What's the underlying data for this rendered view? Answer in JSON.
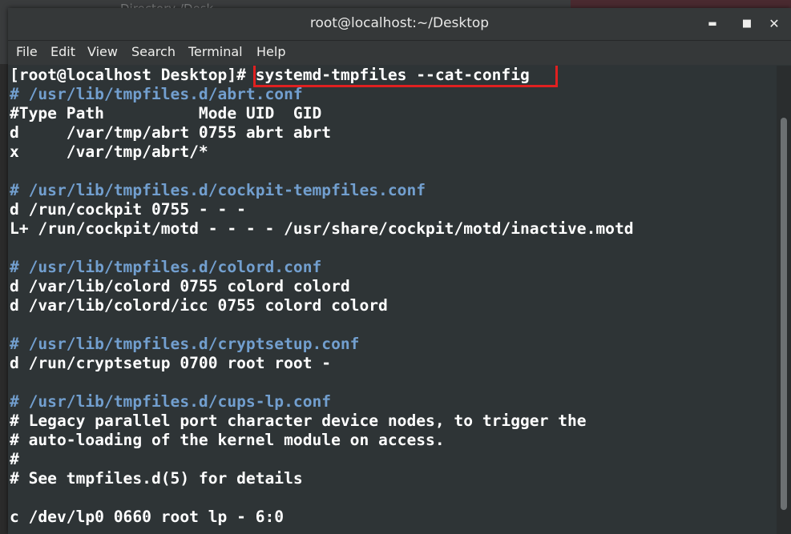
{
  "window": {
    "title": "root@localhost:~/Desktop",
    "bg_title": "Directory /Desk"
  },
  "controls": {
    "minimize": "▬",
    "maximize": "■",
    "close": "✕"
  },
  "menu": {
    "items": [
      "File",
      "Edit",
      "View",
      "Search",
      "Terminal",
      "Help"
    ]
  },
  "terminal": {
    "prompt": "[root@localhost Desktop]# ",
    "command": "systemd-tmpfiles --cat-config",
    "lines": [
      {
        "text": "# /usr/lib/tmpfiles.d/abrt.conf",
        "type": "comment"
      },
      {
        "text": "#Type Path          Mode UID  GID",
        "type": "text"
      },
      {
        "text": "d     /var/tmp/abrt 0755 abrt abrt",
        "type": "text"
      },
      {
        "text": "x     /var/tmp/abrt/*",
        "type": "text"
      },
      {
        "text": "",
        "type": "text"
      },
      {
        "text": "# /usr/lib/tmpfiles.d/cockpit-tempfiles.conf",
        "type": "comment"
      },
      {
        "text": "d /run/cockpit 0755 - - -",
        "type": "text"
      },
      {
        "text": "L+ /run/cockpit/motd - - - - /usr/share/cockpit/motd/inactive.motd",
        "type": "text"
      },
      {
        "text": "",
        "type": "text"
      },
      {
        "text": "# /usr/lib/tmpfiles.d/colord.conf",
        "type": "comment"
      },
      {
        "text": "d /var/lib/colord 0755 colord colord",
        "type": "text"
      },
      {
        "text": "d /var/lib/colord/icc 0755 colord colord",
        "type": "text"
      },
      {
        "text": "",
        "type": "text"
      },
      {
        "text": "# /usr/lib/tmpfiles.d/cryptsetup.conf",
        "type": "comment"
      },
      {
        "text": "d /run/cryptsetup 0700 root root -",
        "type": "text"
      },
      {
        "text": "",
        "type": "text"
      },
      {
        "text": "# /usr/lib/tmpfiles.d/cups-lp.conf",
        "type": "comment"
      },
      {
        "text": "# Legacy parallel port character device nodes, to trigger the",
        "type": "text"
      },
      {
        "text": "# auto-loading of the kernel module on access.",
        "type": "text"
      },
      {
        "text": "#",
        "type": "text"
      },
      {
        "text": "# See tmpfiles.d(5) for details",
        "type": "text"
      },
      {
        "text": "",
        "type": "text"
      },
      {
        "text": "c /dev/lp0 0660 root lp - 6:0",
        "type": "text"
      }
    ]
  },
  "colors": {
    "comment": "#729fcf",
    "text": "#ffffff",
    "highlight": "#e02020",
    "background": "#2e3436"
  }
}
